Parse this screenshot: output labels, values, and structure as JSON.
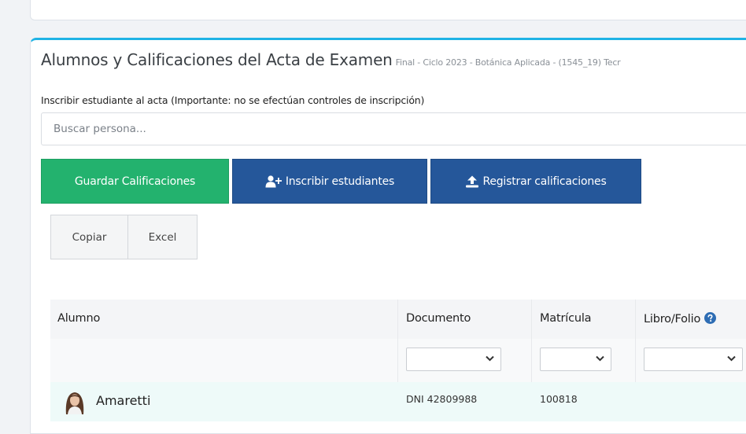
{
  "header": {
    "title": "Alumnos y Calificaciones del Acta de Examen",
    "subtitle": "Final - Ciclo 2023 - Botánica Aplicada - (1545_19) Tecr"
  },
  "enroll": {
    "label": "Inscribir estudiante al acta (Importante: no se efectúan controles de inscripción)",
    "search_placeholder": "Buscar persona..."
  },
  "actions": {
    "save_grades": "Guardar Calificaciones",
    "enroll_students": "Inscribir estudiantes",
    "register_grades": "Registrar calificaciones"
  },
  "export": {
    "copy": "Copiar",
    "excel": "Excel"
  },
  "table": {
    "columns": [
      "Alumno",
      "Documento",
      "Matrícula",
      "Libro/Folio"
    ],
    "rows": [
      {
        "alumno": "Amaretti",
        "documento": "DNI 42809988",
        "matricula": "100818",
        "libro_folio": ""
      }
    ]
  },
  "colors": {
    "accent": "#1fb3e5",
    "green_button": "#23b26e",
    "blue_button": "#25579a",
    "help_icon": "#2e6db4"
  },
  "icons": [
    "add-user-icon",
    "upload-icon",
    "help-icon",
    "chevron-down-icon"
  ]
}
